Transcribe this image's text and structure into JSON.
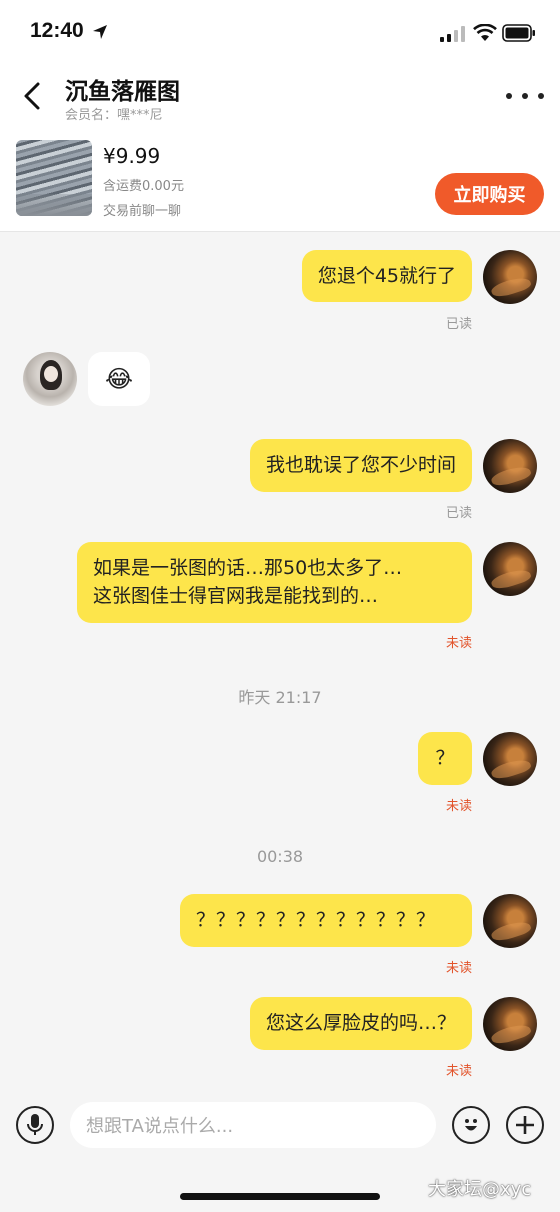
{
  "status_bar": {
    "time": "12:40"
  },
  "header": {
    "title": "沉鱼落雁图",
    "member_label": "会员名：嘿***尼"
  },
  "product": {
    "price": "¥9.99",
    "shipping": "含运费0.00元",
    "hint": "交易前聊一聊",
    "buy_label": "立即购买"
  },
  "messages": [
    {
      "side": "me",
      "text": "您退个45就行了",
      "receipt": "已读"
    },
    {
      "side": "other",
      "text": "😂"
    },
    {
      "side": "me",
      "text": "我也耽误了您不少时间",
      "receipt": "已读"
    },
    {
      "side": "me",
      "text": "如果是一张图的话…那50也太多了…\n这张图佳士得官网我是能找到的…",
      "receipt": "未读"
    },
    {
      "side": "me",
      "text": "？",
      "receipt": "未读"
    },
    {
      "side": "me",
      "text": "？？？？？？？？？？？？",
      "receipt": "未读"
    },
    {
      "side": "me",
      "text": "您这么厚脸皮的吗…？",
      "receipt": "未读"
    }
  ],
  "timestamps": [
    "昨天 21:17",
    "00:38"
  ],
  "input": {
    "placeholder": "想跟TA说点什么..."
  },
  "watermark": "大家坛@xyc",
  "colors": {
    "accent": "#f05a2a",
    "bubble_me": "#fde54b",
    "unread": "#e2542b"
  },
  "icons": [
    "location-arrow-icon",
    "signal-icon",
    "wifi-icon",
    "battery-icon",
    "back-icon",
    "more-icon",
    "microphone-icon",
    "emoji-icon",
    "plus-icon"
  ]
}
